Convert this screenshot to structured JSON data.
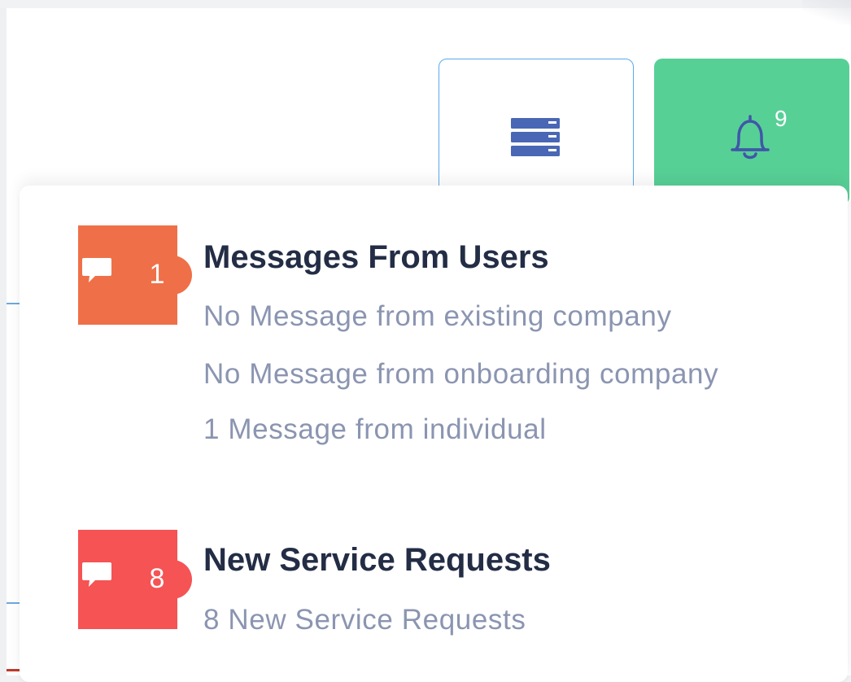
{
  "header": {
    "menu_button": {
      "icon": "server-list-icon",
      "icon_color": "#4a67b5",
      "border_color": "#5aa9ee"
    },
    "notifications_button": {
      "icon": "bell-icon",
      "count": "9",
      "background": "#57d096",
      "icon_color": "#3f57a8"
    }
  },
  "dropdown": {
    "sections": [
      {
        "title": "Messages From Users",
        "badge": {
          "icon": "chat-bubble-icon",
          "count": "1",
          "color": "#ef7048"
        },
        "lines": [
          "No Message from existing company",
          "No Message from onboarding company",
          "1 Message from individual"
        ]
      },
      {
        "title": "New Service Requests",
        "badge": {
          "icon": "chat-bubble-icon",
          "count": "8",
          "color": "#f55354"
        },
        "lines": [
          "8 New Service Requests"
        ]
      }
    ]
  }
}
